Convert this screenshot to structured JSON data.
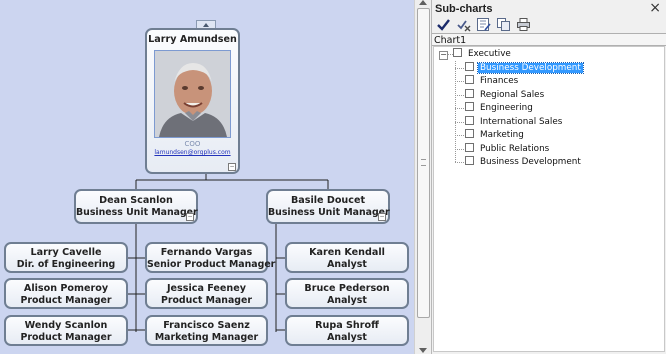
{
  "org_chart": {
    "root": {
      "name": "Larry Amundsen",
      "role": "COO",
      "email": "lamundsen@orgplus.com"
    },
    "managers": [
      {
        "name": "Dean  Scanlon",
        "title": "Business Unit Manager"
      },
      {
        "name": "Basile  Doucet",
        "title": "Business Unit Manager"
      }
    ],
    "left_staff": [
      {
        "name": "Larry  Cavelle",
        "title": "Dir. of Engineering"
      },
      {
        "name": "Alison Pomeroy",
        "title": "Product Manager"
      },
      {
        "name": "Wendy  Scanlon",
        "title": "Product Manager"
      }
    ],
    "middle_staff": [
      {
        "name": "Fernando  Vargas",
        "title": "Senior Product Manager"
      },
      {
        "name": "Jessica  Feeney",
        "title": "Product Manager"
      },
      {
        "name": "Francisco  Saenz",
        "title": "Marketing Manager"
      }
    ],
    "right_staff": [
      {
        "name": "Karen  Kendall",
        "title": "Analyst"
      },
      {
        "name": "Bruce  Pederson",
        "title": "Analyst"
      },
      {
        "name": "Rupa  Shroff",
        "title": "Analyst"
      }
    ]
  },
  "side_panel": {
    "title": "Sub-charts",
    "close_icon": "×",
    "toolbar": [
      {
        "name": "check-icon"
      },
      {
        "name": "uncheck-icon"
      },
      {
        "name": "edit-chart-icon"
      },
      {
        "name": "copy-icon"
      },
      {
        "name": "print-icon"
      }
    ],
    "chart_name": "Chart1",
    "tree": {
      "root_label": "Executive",
      "toggle": "−",
      "items": [
        {
          "label": "Business Development",
          "selected": true
        },
        {
          "label": "Finances",
          "selected": false
        },
        {
          "label": "Regional Sales",
          "selected": false
        },
        {
          "label": "Engineering",
          "selected": false
        },
        {
          "label": "International Sales",
          "selected": false
        },
        {
          "label": "Marketing",
          "selected": false
        },
        {
          "label": "Public Relations",
          "selected": false
        },
        {
          "label": "Business Development",
          "selected": false
        }
      ]
    }
  },
  "colors": {
    "chart_background": "#ccd5f0",
    "node_border": "#6f7e92",
    "selection": "#3399ff",
    "connector": "#222222"
  }
}
